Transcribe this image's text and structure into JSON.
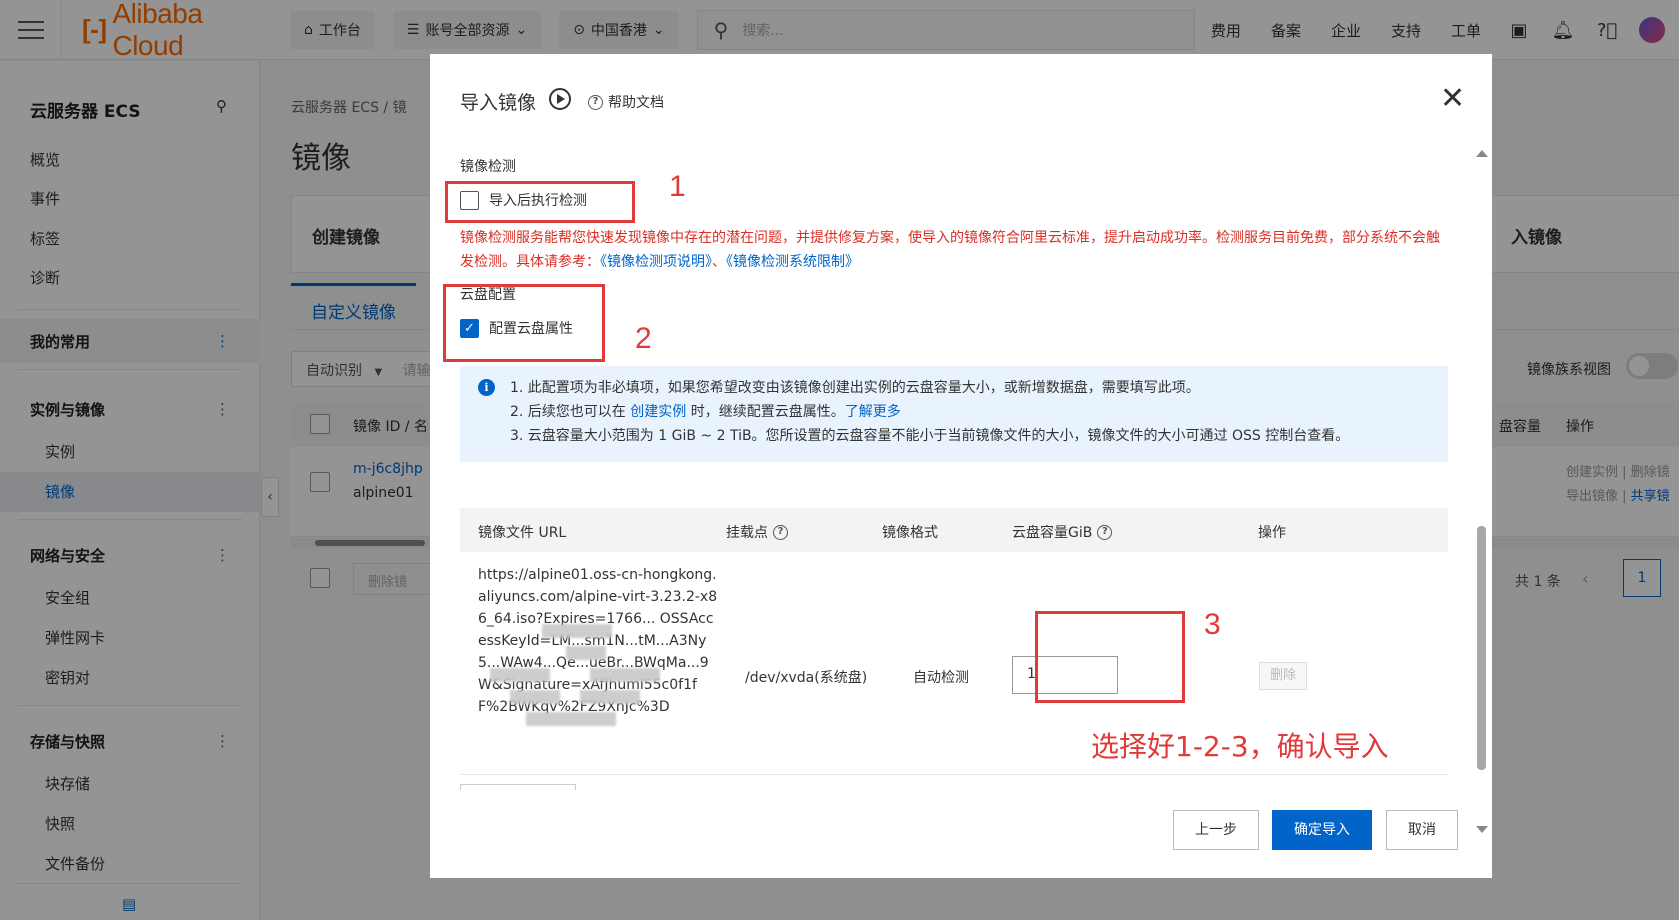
{
  "topbar": {
    "logo_text": "Alibaba Cloud",
    "workbench": "工作台",
    "resources": "账号全部资源",
    "region": "中国香港",
    "search_placeholder": "搜索...",
    "links": [
      "费用",
      "备案",
      "企业",
      "支持",
      "工单"
    ]
  },
  "sidebar": {
    "title": "云服务器 ECS",
    "top_items": [
      "概览",
      "事件",
      "标签",
      "诊断"
    ],
    "groups": {
      "favorites": "我的常用",
      "instances_images": "实例与镜像",
      "network_security": "网络与安全",
      "storage_snapshots": "存储与快照"
    },
    "instances_images_items": [
      "实例",
      "镜像"
    ],
    "network_security_items": [
      "安全组",
      "弹性网卡",
      "密钥对"
    ],
    "storage_snapshots_items": [
      "块存储",
      "快照",
      "文件备份"
    ]
  },
  "background_page": {
    "breadcrumb": "云服务器 ECS  /  镜",
    "title": "镜像",
    "card_left": "创建镜像",
    "card_right": "入镜像",
    "tab": "自定义镜像",
    "filter_select": "自动识别",
    "filter_placeholder": "请输",
    "toggle_label": "镜像族系视图",
    "col_id": "镜像 ID / 名",
    "col_capacity": "盘容量",
    "col_ops": "操作",
    "row_id": "m-j6c8jhp",
    "row_name": "alpine01",
    "row_ops_1": "创建实例  |  删除镜",
    "row_ops_2": "导出镜像  |  ",
    "row_ops_2_link": "共享镜",
    "bulk_delete": "删除镜",
    "total": "共 1 条",
    "current_page": "1"
  },
  "modal": {
    "title": "导入镜像",
    "help_link": "帮助文档",
    "detect_section_label": "镜像检测",
    "detect_checkbox_label": "导入后执行检测",
    "detect_checkbox_checked": false,
    "detect_warning": "镜像检测服务能帮您快速发现镜像中存在的潜在问题，并提供修复方案，使导入的镜像符合阿里云标准，提升启动成功率。检测服务目前免费，部分系统不会触发检测。具体请参考：",
    "detect_link_1": "《镜像检测项说明》",
    "detect_link_sep": "、",
    "detect_link_2": "《镜像检测系统限制》",
    "disk_section_label": "云盘配置",
    "disk_checkbox_label": "配置云盘属性",
    "disk_checkbox_checked": true,
    "info_line_1": "1. 此配置项为非必填项，如果您希望改变由该镜像创建出实例的云盘容量大小，或新增数据盘，需要填写此项。",
    "info_line_2_pre": "2. 后续您也可以在 ",
    "info_line_2_link": "创建实例",
    "info_line_2_post": " 时，继续配置云盘属性。",
    "info_line_2_more": "了解更多",
    "info_line_3": "3. 云盘容量大小范围为 1 GiB ~ 2 TiB。您所设置的云盘容量不能小于当前镜像文件的大小，镜像文件的大小可通过 OSS 控制台查看。",
    "table": {
      "col_url": "镜像文件 URL",
      "col_mount": "挂载点",
      "col_format": "镜像格式",
      "col_capacity": "云盘容量GiB",
      "col_ops": "操作",
      "row": {
        "url": "https://alpine01.oss-cn-hongkong.aliyuncs.com/alpine-virt-3.23.2-x86_64.iso?Expires=1766... OSSAccessKeyId=LM...sm1N...tM...A3Ny5...WAw4...Qe...ueBr...BWqMa...9W&Signature=xAfJhuml55c0f1fF%2BWKqv%2FZ9XnJc%3D",
        "mount": "/dev/xvda(系统盘)",
        "format": "自动检测",
        "capacity": "1",
        "delete": "删除"
      }
    },
    "btn_prev": "上一步",
    "btn_confirm": "确定导入",
    "btn_cancel": "取消"
  },
  "annotations": {
    "n1": "1",
    "n2": "2",
    "n3": "3",
    "note": "选择好1-2-3，确认导入",
    "color": "#e03a3a"
  },
  "colors": {
    "accent": "#0064c8",
    "brand": "#ff6a00",
    "warning": "#d93026"
  }
}
